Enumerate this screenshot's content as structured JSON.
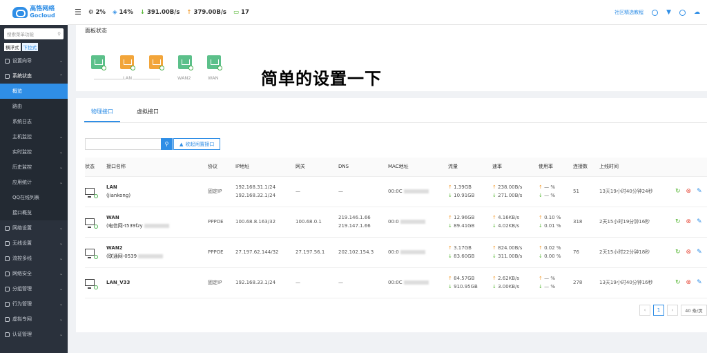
{
  "brand": {
    "name_cn": "高恪网络",
    "name_en": "Gocloud"
  },
  "sidebar": {
    "search_placeholder": "搜索菜单功能",
    "modes": [
      "横浮式",
      "下拉式"
    ],
    "items": [
      {
        "label": "设置向导",
        "expanded": false
      },
      {
        "label": "系统状态",
        "expanded": true,
        "children": [
          "概览",
          "路由",
          "系统日志",
          "主机监控",
          "实时监控",
          "历史监控",
          "应用统计",
          "QQ在线列表",
          "接口概览"
        ]
      },
      {
        "label": "网络设置"
      },
      {
        "label": "无线设置"
      },
      {
        "label": "流控多线"
      },
      {
        "label": "网络安全"
      },
      {
        "label": "分组管理"
      },
      {
        "label": "行为管理"
      },
      {
        "label": "虚拟专网"
      },
      {
        "label": "认证管理"
      }
    ]
  },
  "topbar": {
    "cpu": "2%",
    "mem": "14%",
    "down": "391.00B/s",
    "up": "379.00B/s",
    "devices": "17",
    "help": "社区精选教程"
  },
  "panel": {
    "title": "面板状态",
    "ports": [
      "LAN",
      "WAN2",
      "WAN"
    ],
    "annotation": "简单的设置一下"
  },
  "tabs": [
    "物理接口",
    "虚拟接口"
  ],
  "filter": {
    "collapse_label": "收起闲置接口"
  },
  "table": {
    "headers": [
      "状态",
      "接口名称",
      "协议",
      "IP地址",
      "网关",
      "DNS",
      "MAC地址",
      "流量",
      "速率",
      "使用率",
      "连接数",
      "上线时间"
    ],
    "rows": [
      {
        "name": "LAN",
        "sub": "(jiankong)",
        "proto": "固定IP",
        "ip1": "192.168.31.1/24",
        "ip2": "192.168.32.1/24",
        "gw": "—",
        "dns1": "—",
        "dns2": "",
        "mac": "00:0C",
        "t_up": "1.39GB",
        "t_dn": "10.91GB",
        "r_up": "238.00B/s",
        "r_dn": "271.00B/s",
        "u_up": "— %",
        "u_dn": "— %",
        "conn": "51",
        "online": "13天19小时40分钟24秒"
      },
      {
        "name": "WAN",
        "sub": "(电信网-t539fzy",
        "proto": "PPPOE",
        "ip1": "100.68.8.163/32",
        "ip2": "",
        "gw": "100.68.0.1",
        "dns1": "219.146.1.66",
        "dns2": "219.147.1.66",
        "mac": "00:0",
        "t_up": "12.96GB",
        "t_dn": "89.41GB",
        "r_up": "4.16KB/s",
        "r_dn": "4.02KB/s",
        "u_up": "0.10 %",
        "u_dn": "0.01 %",
        "conn": "318",
        "online": "2天15小时19分钟16秒"
      },
      {
        "name": "WAN2",
        "sub": "(联通网-0539",
        "proto": "PPPOE",
        "ip1": "27.197.62.144/32",
        "ip2": "",
        "gw": "27.197.56.1",
        "dns1": "202.102.154.3",
        "dns2": "",
        "mac": "00:0",
        "t_up": "3.17GB",
        "t_dn": "83.60GB",
        "r_up": "824.00B/s",
        "r_dn": "311.00B/s",
        "u_up": "0.02 %",
        "u_dn": "0.00 %",
        "conn": "76",
        "online": "2天15小时22分钟18秒"
      },
      {
        "name": "LAN_V33",
        "sub": "",
        "proto": "固定IP",
        "ip1": "192.168.33.1/24",
        "ip2": "",
        "gw": "—",
        "dns1": "—",
        "dns2": "",
        "mac": "00:0C",
        "t_up": "84.57GB",
        "t_dn": "910.95GB",
        "r_up": "2.62KB/s",
        "r_dn": "3.00KB/s",
        "u_up": "— %",
        "u_dn": "— %",
        "conn": "278",
        "online": "13天19小时40分钟16秒"
      }
    ]
  },
  "pager": {
    "page": "1",
    "size": "40 条/页"
  }
}
